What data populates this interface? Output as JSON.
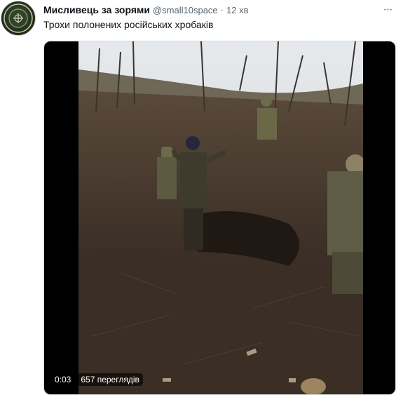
{
  "tweet": {
    "author_name": "Мисливець за зорями",
    "author_handle": "@small10space",
    "separator": "·",
    "time_ago": "12 хв",
    "text": "Трохи полонених російських хробаків",
    "more_icon": "more-horizontal-icon"
  },
  "video": {
    "duration": "0:03",
    "views": "657 переглядів"
  },
  "colors": {
    "text_primary": "#0f1419",
    "text_secondary": "#536471",
    "media_bg": "#000000"
  }
}
